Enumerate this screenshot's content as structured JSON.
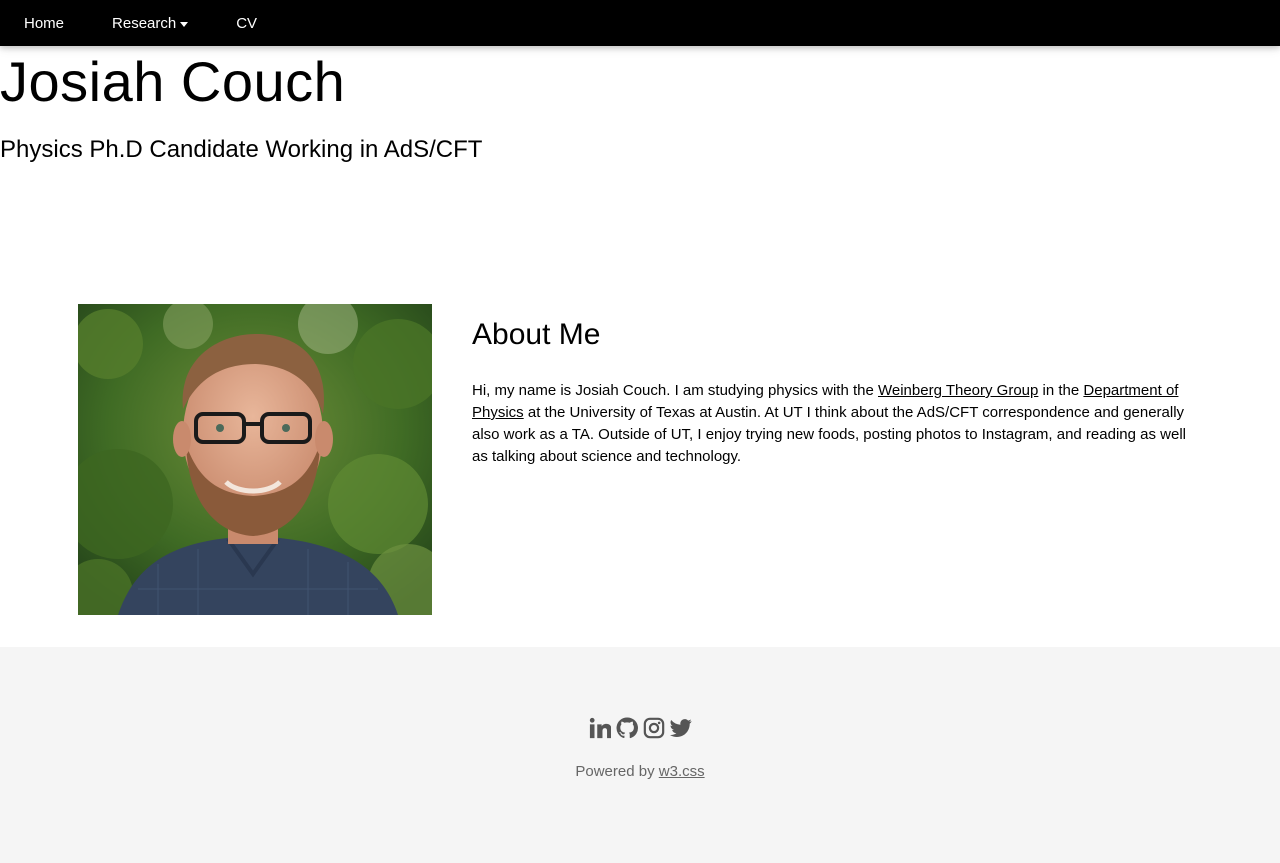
{
  "nav": {
    "home": "Home",
    "research": "Research",
    "cv": "CV"
  },
  "header": {
    "title": "Josiah Couch",
    "subtitle": "Physics Ph.D Candidate Working in AdS/CFT"
  },
  "about": {
    "heading": "About Me",
    "text_1": "Hi, my name is Josiah Couch. I am studying physics with the ",
    "link_1": "Weinberg Theory Group",
    "text_2": " in the ",
    "link_2": "Department of Physics",
    "text_3": " at the University of Texas at Austin. At UT I think about the AdS/CFT correspondence and generally also work as a TA. Outside of UT, I enjoy trying new foods, posting photos to Instagram, and reading as well as talking about science and technology."
  },
  "footer": {
    "powered_prefix": "Powered by ",
    "powered_link": "w3.css",
    "icons": [
      "linkedin-icon",
      "github-icon",
      "instagram-icon",
      "twitter-icon"
    ],
    "icon_color": "#555555"
  },
  "colors": {
    "navbar_bg": "#000000",
    "footer_bg": "#f5f5f5"
  }
}
